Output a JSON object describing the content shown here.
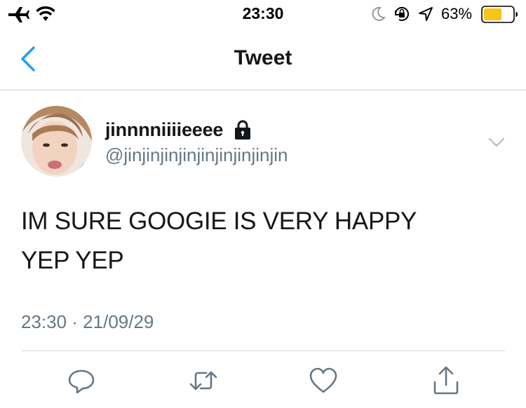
{
  "status_bar": {
    "time": "23:30",
    "battery_percent": "63%",
    "battery_level": 0.63,
    "icons": [
      "airplane-icon",
      "wifi-icon",
      "moon-icon",
      "orientation-lock-icon",
      "location-icon",
      "battery-icon"
    ]
  },
  "nav": {
    "back_icon": "chevron-left-icon",
    "title": "Tweet"
  },
  "tweet": {
    "display_name": "jinnnniiiieeee",
    "protected_icon": "lock-icon",
    "handle": "@jinjinjinjinjinjinjinjinjin",
    "menu_icon": "chevron-down-icon",
    "text_line1": "IM SURE GOOGIE IS VERY HAPPY",
    "text_line2": "YEP YEP",
    "timestamp": "23:30 · 21/09/29"
  },
  "actions": {
    "icons": [
      "reply-icon",
      "retweet-icon",
      "like-icon",
      "share-icon"
    ]
  },
  "colors": {
    "accent": "#1da1f2",
    "text": "#14171a",
    "secondary_text": "#657786",
    "icon_gray": "#657786",
    "battery_fill": "#f5c518",
    "divider": "#c8ccd0"
  }
}
